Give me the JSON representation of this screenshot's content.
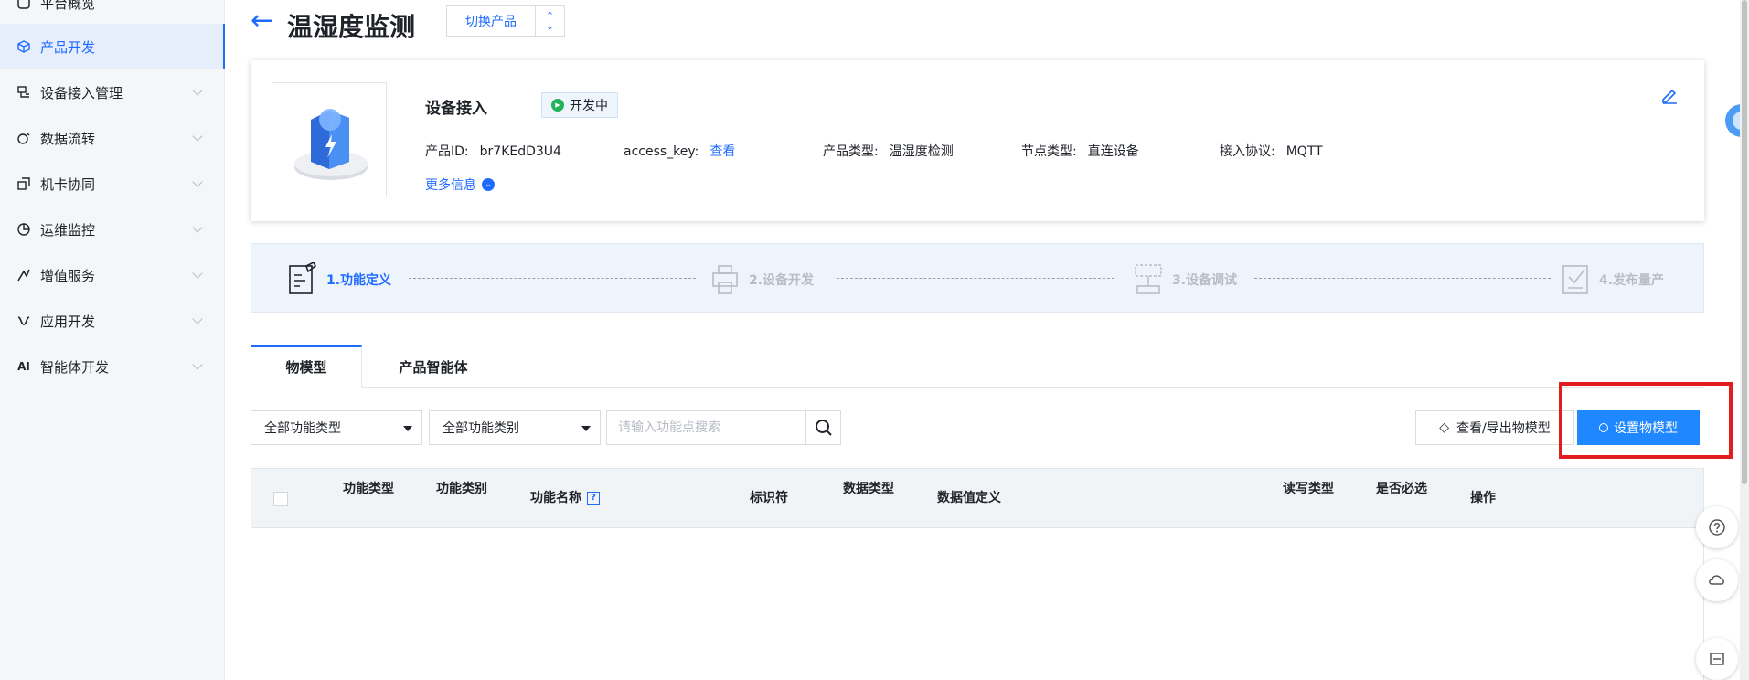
{
  "sidebar": {
    "items": [
      {
        "label": "平台概览",
        "icon": "overview-icon"
      },
      {
        "label": "产品开发",
        "icon": "cube-icon",
        "active": true
      },
      {
        "label": "设备接入管理",
        "icon": "device-icon"
      },
      {
        "label": "数据流转",
        "icon": "flow-icon"
      },
      {
        "label": "机卡协同",
        "icon": "card-icon"
      },
      {
        "label": "运维监控",
        "icon": "monitor-icon"
      },
      {
        "label": "增值服务",
        "icon": "service-icon"
      },
      {
        "label": "应用开发",
        "icon": "app-icon"
      },
      {
        "label": "智能体开发",
        "icon": "ai-icon",
        "icon_text": "AI"
      }
    ]
  },
  "header": {
    "title": "温湿度监测",
    "switch_product": "切换产品"
  },
  "product": {
    "section_title": "设备接入",
    "status": "开发中",
    "fields": {
      "product_id_label": "产品ID:",
      "product_id": "br7KEdD3U4",
      "access_key_label": "access_key:",
      "access_key_link": "查看",
      "type_label": "产品类型:",
      "type": "温湿度检测",
      "node_label": "节点类型:",
      "node": "直连设备",
      "protocol_label": "接入协议:",
      "protocol": "MQTT"
    },
    "more_info": "更多信息"
  },
  "steps": [
    {
      "label": "1.功能定义",
      "active": true
    },
    {
      "label": "2.设备开发"
    },
    {
      "label": "3.设备调试"
    },
    {
      "label": "4.发布量产"
    }
  ],
  "tabs": [
    {
      "label": "物模型",
      "active": true
    },
    {
      "label": "产品智能体"
    }
  ],
  "filters": {
    "function_type": "全部功能类型",
    "function_category": "全部功能类别",
    "search_placeholder": "请输入功能点搜索"
  },
  "actions": {
    "view_export": "查看/导出物模型",
    "set_model": "设置物模型"
  },
  "table": {
    "columns": [
      "功能类型",
      "功能类别",
      "功能名称",
      "标识符",
      "数据类型",
      "数据值定义",
      "读写类型",
      "是否必选",
      "操作"
    ]
  },
  "colors": {
    "accent": "#1f6bff",
    "primary_button": "#1f87ff",
    "highlight": "#e11d1d",
    "status_green": "#21b45a"
  }
}
